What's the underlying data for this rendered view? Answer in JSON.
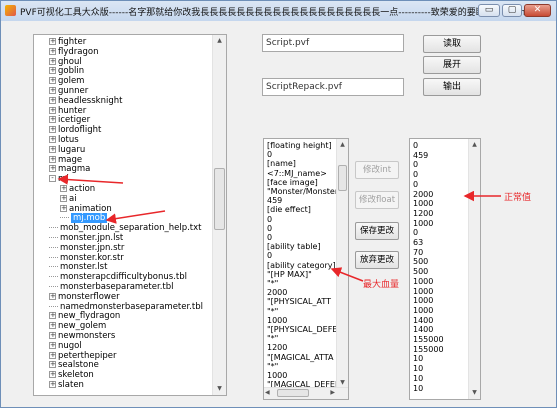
{
  "title": "PVF可视化工具大众版------名字那就给你改我長長長長長長長長長長長長長長長長長長長長一点----------致荣爱的要断谁：Sound",
  "window_controls": {
    "minimize": "▭",
    "restore": "▢",
    "close": "✕"
  },
  "tree": {
    "items": [
      {
        "text": "fighter",
        "level": 0,
        "exp": "+"
      },
      {
        "text": "flydragon",
        "level": 0,
        "exp": "+"
      },
      {
        "text": "ghoul",
        "level": 0,
        "exp": "+"
      },
      {
        "text": "goblin",
        "level": 0,
        "exp": "+"
      },
      {
        "text": "golem",
        "level": 0,
        "exp": "+"
      },
      {
        "text": "gunner",
        "level": 0,
        "exp": "+"
      },
      {
        "text": "headlessknight",
        "level": 0,
        "exp": "+"
      },
      {
        "text": "hunter",
        "level": 0,
        "exp": "+"
      },
      {
        "text": "icetiger",
        "level": 0,
        "exp": "+"
      },
      {
        "text": "lordoflight",
        "level": 0,
        "exp": "+"
      },
      {
        "text": "lotus",
        "level": 0,
        "exp": "+"
      },
      {
        "text": "lugaru",
        "level": 0,
        "exp": "+"
      },
      {
        "text": "mage",
        "level": 0,
        "exp": "+"
      },
      {
        "text": "magma",
        "level": 0,
        "exp": "+"
      },
      {
        "text": "mj",
        "level": 0,
        "exp": "-"
      },
      {
        "text": "action",
        "level": 1,
        "exp": "+"
      },
      {
        "text": "ai",
        "level": 1,
        "exp": "+"
      },
      {
        "text": "animation",
        "level": 1,
        "exp": "+"
      },
      {
        "text": "mj.mob",
        "level": 1,
        "exp": "",
        "selected": true
      },
      {
        "text": "mob_module_separation_help.txt",
        "level": 0,
        "exp": ""
      },
      {
        "text": "monster.jpn.lst",
        "level": 0,
        "exp": ""
      },
      {
        "text": "monster.jpn.str",
        "level": 0,
        "exp": ""
      },
      {
        "text": "monster.kor.str",
        "level": 0,
        "exp": ""
      },
      {
        "text": "monster.lst",
        "level": 0,
        "exp": ""
      },
      {
        "text": "monsterapcdifficultybonus.tbl",
        "level": 0,
        "exp": ""
      },
      {
        "text": "monsterbaseparameter.tbl",
        "level": 0,
        "exp": ""
      },
      {
        "text": "monsterflower",
        "level": 0,
        "exp": "+"
      },
      {
        "text": "namedmonsterbaseparameter.tbl",
        "level": 0,
        "exp": ""
      },
      {
        "text": "new_flydragon",
        "level": 0,
        "exp": "+"
      },
      {
        "text": "new_golem",
        "level": 0,
        "exp": "+"
      },
      {
        "text": "newmonsters",
        "level": 0,
        "exp": "+"
      },
      {
        "text": "nugol",
        "level": 0,
        "exp": "+"
      },
      {
        "text": "peterthepiper",
        "level": 0,
        "exp": "+"
      },
      {
        "text": "sealstone",
        "level": 0,
        "exp": "+"
      },
      {
        "text": "skeleton",
        "level": 0,
        "exp": "+"
      },
      {
        "text": "slaten",
        "level": 0,
        "exp": "+"
      }
    ]
  },
  "script_field": "Script.pvf",
  "repack_field": "ScriptRepack.pvf",
  "buttons": {
    "read": "读取",
    "expand": "展开",
    "output": "输出",
    "edit_int": "修改int",
    "edit_float": "修改float",
    "save_changes": "保存更改",
    "discard_changes": "放弃更改"
  },
  "script_text": [
    "[floating height]",
    "0",
    "[name]",
    "<7::MJ_name>",
    "[face image]",
    "\"Monster/Monster",
    "459",
    "[die effect]",
    "0",
    "0",
    "0",
    "[ability table]",
    "0",
    "[ability category]",
    "\"[HP MAX]\"",
    "\"*\"",
    "2000",
    "\"[PHYSICAL_ATT",
    "\"*\"",
    "1000",
    "\"[PHYSICAL_DEFE",
    "\"*\"",
    "1200",
    "\"[MAGICAL_ATTA",
    "\"*\"",
    "1000",
    "\"[MAGICAL_DEFEI"
  ],
  "values_list": [
    "0",
    "459",
    "0",
    "0",
    "0",
    "2000",
    "1000",
    "1200",
    "1000",
    "0",
    "63",
    "70",
    "500",
    "500",
    "1000",
    "1000",
    "1000",
    "1000",
    "1400",
    "1400",
    "155000",
    "155000",
    "10",
    "10",
    "10",
    "10"
  ],
  "annotations": {
    "normal_value": "正常值",
    "max_hp": "最大血量"
  },
  "colors": {
    "annotation": "#e8272a",
    "selection": "#3399ff",
    "titlebar": "#c5d7ee"
  }
}
